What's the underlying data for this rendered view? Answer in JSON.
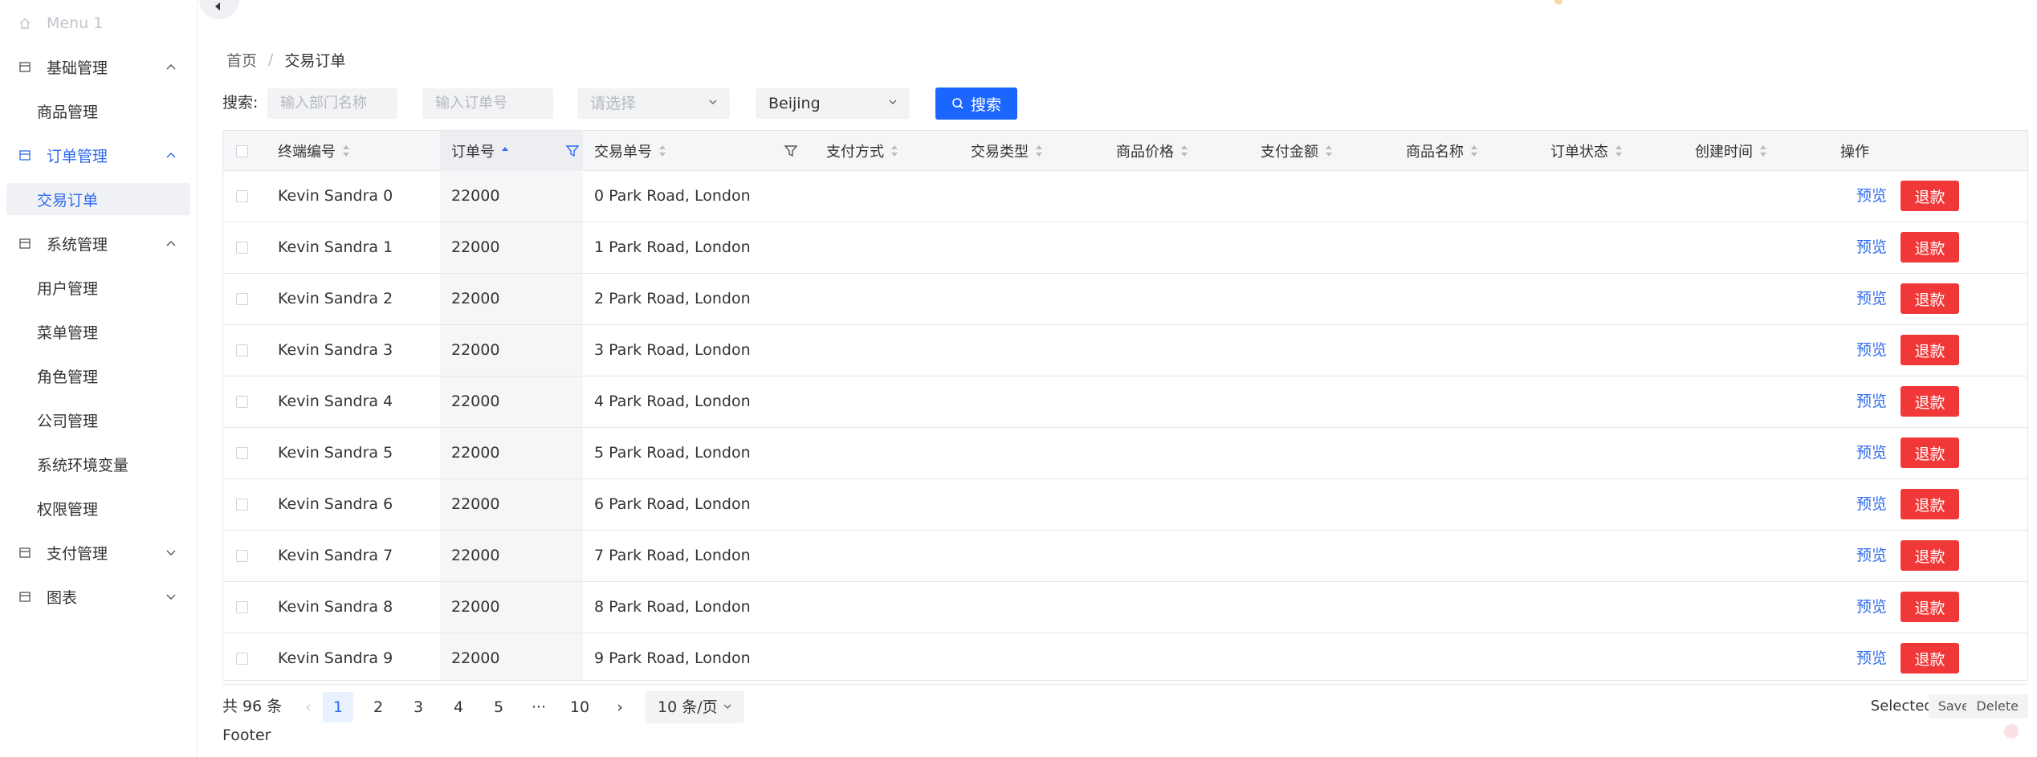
{
  "sidebar": {
    "items": [
      {
        "label": "Menu 1"
      },
      {
        "label": "基础管理",
        "children": [
          {
            "label": "商品管理"
          }
        ]
      },
      {
        "label": "订单管理",
        "children": [
          {
            "label": "交易订单"
          }
        ]
      },
      {
        "label": "系统管理",
        "children": [
          {
            "label": "用户管理"
          },
          {
            "label": "菜单管理"
          },
          {
            "label": "角色管理"
          },
          {
            "label": "公司管理"
          },
          {
            "label": "系统环境变量"
          },
          {
            "label": "权限管理"
          }
        ]
      },
      {
        "label": "支付管理"
      },
      {
        "label": "图表"
      }
    ]
  },
  "breadcrumb": {
    "home": "首页",
    "separator": "/",
    "current": "交易订单"
  },
  "search": {
    "label": "搜索:",
    "dept_placeholder": "输入部门名称",
    "order_placeholder": "输入订单号",
    "select_placeholder": "请选择",
    "city_value": "Beijing",
    "button_label": "搜索"
  },
  "table": {
    "columns": [
      "终端编号",
      "订单号",
      "交易单号",
      "支付方式",
      "交易类型",
      "商品价格",
      "支付金额",
      "商品名称",
      "订单状态",
      "创建时间",
      "操作"
    ],
    "rows": [
      {
        "terminal": "Kevin Sandra 0",
        "order_no": "22000",
        "trade_no": "0 Park Road, London"
      },
      {
        "terminal": "Kevin Sandra 1",
        "order_no": "22000",
        "trade_no": "1 Park Road, London"
      },
      {
        "terminal": "Kevin Sandra 2",
        "order_no": "22000",
        "trade_no": "2 Park Road, London"
      },
      {
        "terminal": "Kevin Sandra 3",
        "order_no": "22000",
        "trade_no": "3 Park Road, London"
      },
      {
        "terminal": "Kevin Sandra 4",
        "order_no": "22000",
        "trade_no": "4 Park Road, London"
      },
      {
        "terminal": "Kevin Sandra 5",
        "order_no": "22000",
        "trade_no": "5 Park Road, London"
      },
      {
        "terminal": "Kevin Sandra 6",
        "order_no": "22000",
        "trade_no": "6 Park Road, London"
      },
      {
        "terminal": "Kevin Sandra 7",
        "order_no": "22000",
        "trade_no": "7 Park Road, London"
      },
      {
        "terminal": "Kevin Sandra 8",
        "order_no": "22000",
        "trade_no": "8 Park Road, London"
      },
      {
        "terminal": "Kevin Sandra 9",
        "order_no": "22000",
        "trade_no": "9 Park Road, London"
      }
    ],
    "action_preview": "预览",
    "action_refund": "退款"
  },
  "pagination": {
    "total": "共 96 条",
    "pages": [
      "1",
      "2",
      "3",
      "4",
      "5",
      "···",
      "10"
    ],
    "current": "1",
    "page_size": "10 条/页",
    "prev_icon": "chevron-left-icon",
    "next_icon": "chevron-right-icon"
  },
  "footer_bar": {
    "selected": "Selected 0",
    "save": "Save",
    "delete": "Delete"
  },
  "footer": "Footer",
  "colors": {
    "accent": "#2f6bf0",
    "primary_button": "#1a66ff",
    "danger": "#f03838"
  }
}
